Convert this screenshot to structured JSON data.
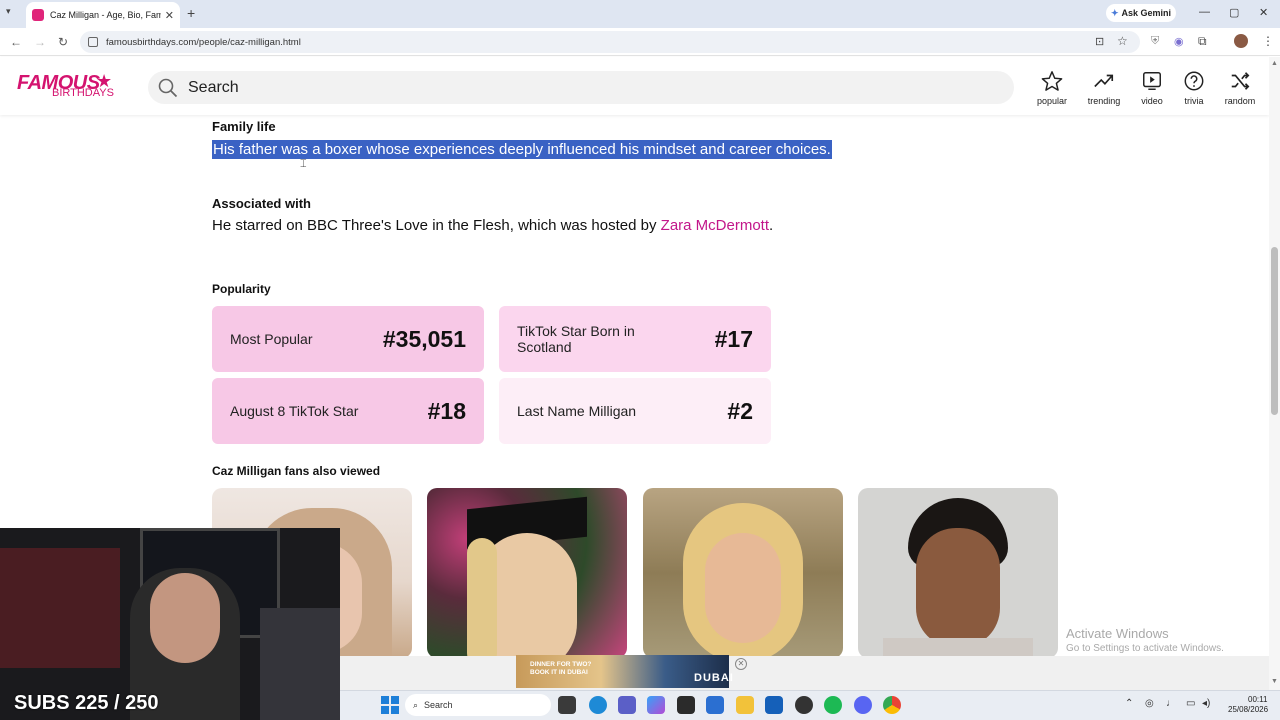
{
  "browser": {
    "tab_title": "Caz Milligan - Age, Bio, Family |",
    "tab_close": "✕",
    "new_tab": "+",
    "ask_gemini": "Ask Gemini",
    "url": "famousbirthdays.com/people/caz-milligan.html"
  },
  "site": {
    "logo_top": "FAMOUS",
    "logo_bottom": "BIRTHDAYS",
    "search_placeholder": "Search",
    "nav": [
      {
        "label": "popular",
        "icon": "star-icon"
      },
      {
        "label": "trending",
        "icon": "trending-icon"
      },
      {
        "label": "video",
        "icon": "video-icon"
      },
      {
        "label": "trivia",
        "icon": "question-icon"
      },
      {
        "label": "random",
        "icon": "shuffle-icon"
      }
    ]
  },
  "content": {
    "family_heading": "Family life",
    "family_text": "His father was a boxer whose experiences deeply influenced his mindset and career choices.",
    "assoc_heading": "Associated with",
    "assoc_text_before": "He starred on BBC Three's Love in the Flesh, which was hosted by ",
    "assoc_link": "Zara McDermott",
    "assoc_text_after": ".",
    "popularity_heading": "Popularity",
    "popularity": [
      {
        "label": "Most Popular",
        "rank": "#35,051",
        "bg": "#f7c8e6"
      },
      {
        "label": "TikTok Star Born in Scotland",
        "rank": "#17",
        "bg": "#fbd6ee"
      },
      {
        "label": "August 8 TikTok Star",
        "rank": "#18",
        "bg": "#f7c8e6"
      },
      {
        "label": "Last Name Milligan",
        "rank": "#2",
        "bg": "#fdeef7"
      }
    ],
    "fans_heading": "Caz Milligan fans also viewed"
  },
  "overlay": {
    "subs": "SUBS 225 / 250",
    "activate_title": "Activate Windows",
    "activate_sub": "Go to Settings to activate Windows."
  },
  "ad": {
    "left_text": "DINNER FOR TWO?\nBOOK IT IN DUBAI",
    "right_text": "DUBAI",
    "close": "✕"
  },
  "taskbar": {
    "search_label": "Search",
    "time": "00:11",
    "date": "25/08/2026"
  },
  "colors": {
    "brand": "#d4136f",
    "link": "#c2168a",
    "selection": "#3a62c4"
  }
}
